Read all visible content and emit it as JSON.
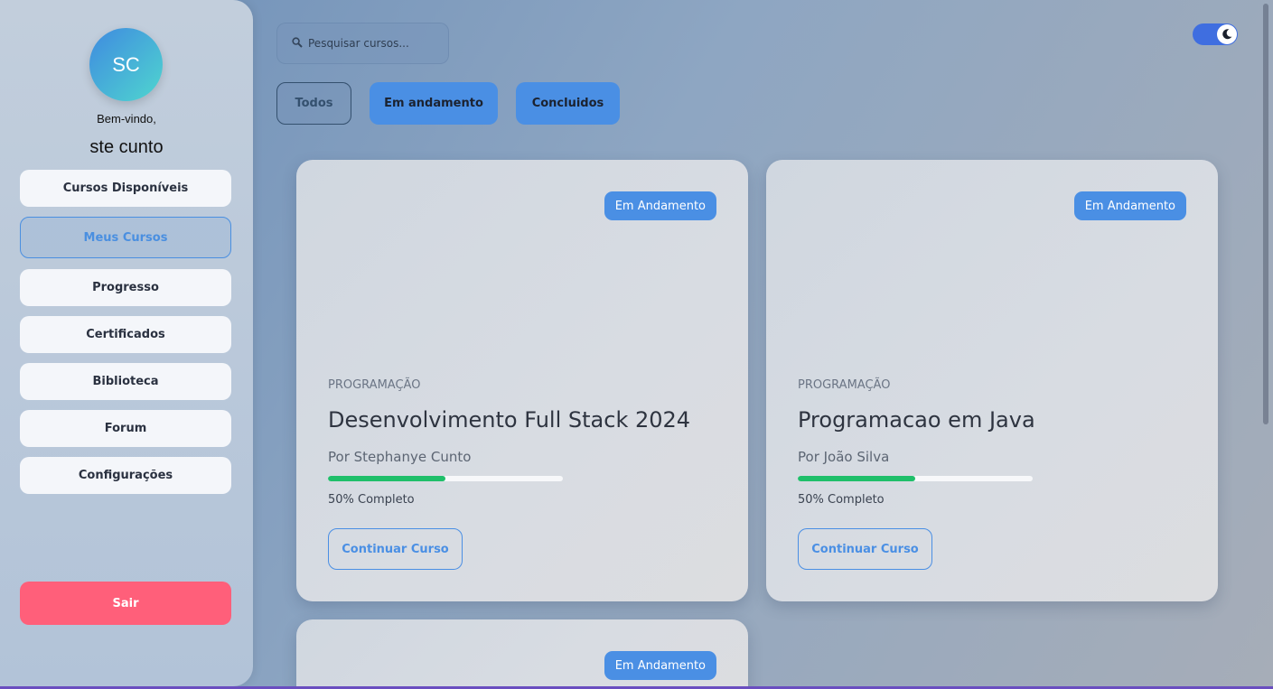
{
  "sidebar": {
    "avatar_initials": "SC",
    "welcome": "Bem-vindo,",
    "username": "ste cunto",
    "nav": [
      {
        "label": "Cursos Disponíveis",
        "active": false
      },
      {
        "label": "Meus Cursos",
        "active": true
      },
      {
        "label": "Progresso",
        "active": false
      },
      {
        "label": "Certificados",
        "active": false
      },
      {
        "label": "Biblioteca",
        "active": false
      },
      {
        "label": "Forum",
        "active": false
      },
      {
        "label": "Configurações",
        "active": false
      }
    ],
    "logout_label": "Sair"
  },
  "search": {
    "icon": "search-icon",
    "placeholder": "Pesquisar cursos..."
  },
  "filters": [
    {
      "label": "Todos",
      "selected": true
    },
    {
      "label": "Em andamento",
      "selected": false
    },
    {
      "label": "Concluidos",
      "selected": false
    }
  ],
  "theme_toggle": {
    "icon": "moon-icon",
    "on": true
  },
  "courses": [
    {
      "status": "Em Andamento",
      "category": "PROGRAMAÇÃO",
      "title": "Desenvolvimento Full Stack 2024",
      "author": "Por Stephanye Cunto",
      "progress": 0.5,
      "progress_text": "50% Completo",
      "action": "Continuar Curso"
    },
    {
      "status": "Em Andamento",
      "category": "PROGRAMAÇÃO",
      "title": "Programacao em Java",
      "author": "Por João Silva",
      "progress": 0.5,
      "progress_text": "50% Completo",
      "action": "Continuar Curso"
    },
    {
      "status": "Em Andamento"
    }
  ],
  "colors": {
    "accent": "#4a8fe4",
    "progress": "#1fbf6a",
    "logout": "#ff5f7a",
    "toggle": "#3f6ee0"
  }
}
